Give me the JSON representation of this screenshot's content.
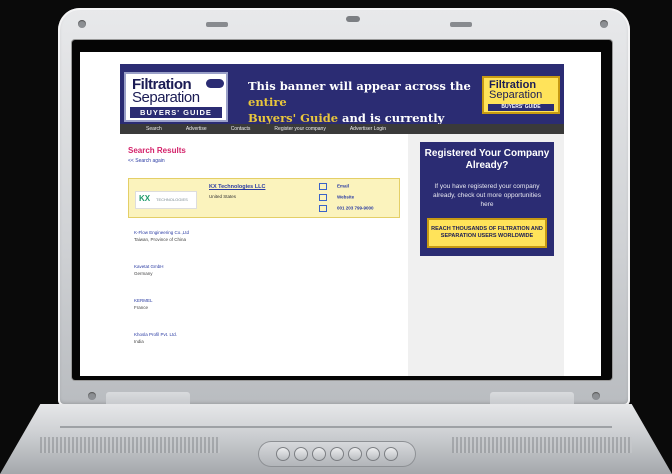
{
  "banner": {
    "logo_line1": "Filtration",
    "logo_line2": "Separation",
    "logo_badge": "BUYERS' GUIDE",
    "tagline_pre": "This banner will appear across the ",
    "tagline_hl1": "entire",
    "tagline_mid": "Buyers' Guide",
    "tagline_post": " and is currently available"
  },
  "nav": [
    "Search",
    "Advertise",
    "Contacts",
    "Register your company",
    "Advertiser Login"
  ],
  "results": {
    "title": "Search Results",
    "search_again": "<< Search again",
    "featured": {
      "logo_text": "KX",
      "logo_sub": "TECHNOLOGIES",
      "name": "KX Technologies LLC",
      "country": "United States",
      "email_label": "Email",
      "website_label": "Website",
      "phone": "001 203 799-9000"
    },
    "companies": [
      {
        "name": "K-Flow Engineering Co.,Ltd",
        "location": "Taiwan, Province of China"
      },
      {
        "name": "Kavetat GmbH",
        "location": "Germany"
      },
      {
        "name": "KERMEL",
        "location": "France"
      },
      {
        "name": "Khosla Profil Pvt. Ltd.",
        "location": "India"
      }
    ]
  },
  "promo": {
    "heading": "Registered Your Company Already?",
    "body": "If you have registered your company already, check out more opportunities here",
    "cta": "REACH THOUSANDS OF FILTRATION AND SEPARATION USERS WORLDWIDE"
  }
}
